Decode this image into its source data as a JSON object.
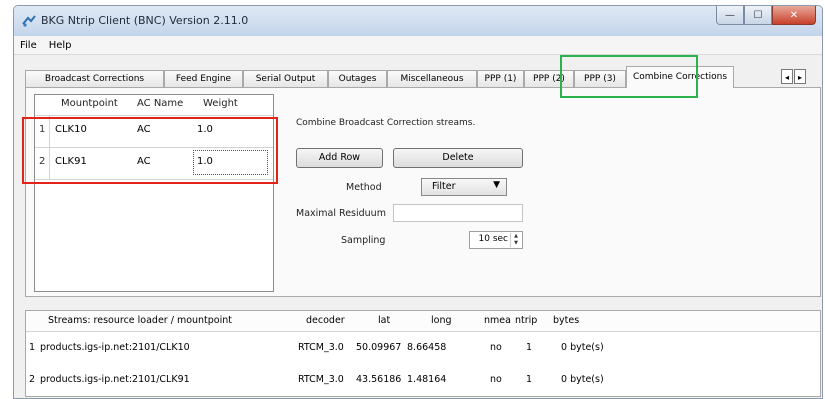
{
  "window": {
    "title": "BKG Ntrip Client (BNC) Version 2.11.0",
    "controls": [
      "minimize",
      "maximize",
      "close"
    ]
  },
  "menu": [
    "File",
    "Help"
  ],
  "tabs": [
    {
      "label": "Broadcast Corrections"
    },
    {
      "label": "Feed Engine"
    },
    {
      "label": "Serial Output"
    },
    {
      "label": "Outages"
    },
    {
      "label": "Miscellaneous"
    },
    {
      "label": "PPP (1)"
    },
    {
      "label": "PPP (2)"
    },
    {
      "label": "PPP (3)"
    },
    {
      "label": "Combine Corrections",
      "active": true
    }
  ],
  "tab_nav": {
    "left": "◂",
    "right": "▸"
  },
  "combine": {
    "columns": [
      "Mountpoint",
      "AC Name",
      "Weight"
    ],
    "rows": [
      {
        "num": "1",
        "mountpoint": "CLK10",
        "ac_name": "AC",
        "weight": "1.0"
      },
      {
        "num": "2",
        "mountpoint": "CLK91",
        "ac_name": "AC",
        "weight": "1.0"
      }
    ],
    "description": "Combine Broadcast Correction streams.",
    "add_row": "Add Row",
    "delete": "Delete",
    "method_label": "Method",
    "method_value": "Filter",
    "maximal_residuum_label": "Maximal Residuum",
    "maximal_residuum_value": "",
    "sampling_label": "Sampling",
    "sampling_value": "10 sec"
  },
  "streams": {
    "headers": {
      "streams": "Streams:  resource loader / mountpoint",
      "decoder": "decoder",
      "lat": "lat",
      "long": "long",
      "nmea": "nmea",
      "ntrip": "ntrip",
      "bytes": "bytes"
    },
    "rows": [
      {
        "num": "1",
        "mount": "products.igs-ip.net:2101/CLK10",
        "decoder": "RTCM_3.0",
        "lat": "50.09967",
        "long": "8.66458",
        "nmea": "no",
        "ntrip": "1",
        "bytes": "0 byte(s)"
      },
      {
        "num": "2",
        "mount": "products.igs-ip.net:2101/CLK91",
        "decoder": "RTCM_3.0",
        "lat": "43.56186",
        "long": "1.48164",
        "nmea": "no",
        "ntrip": "1",
        "bytes": "0 byte(s)"
      }
    ]
  },
  "colors": {
    "highlight_red": "#e2231a",
    "highlight_green": "#2bb24c",
    "close_button": "#c7412b"
  }
}
